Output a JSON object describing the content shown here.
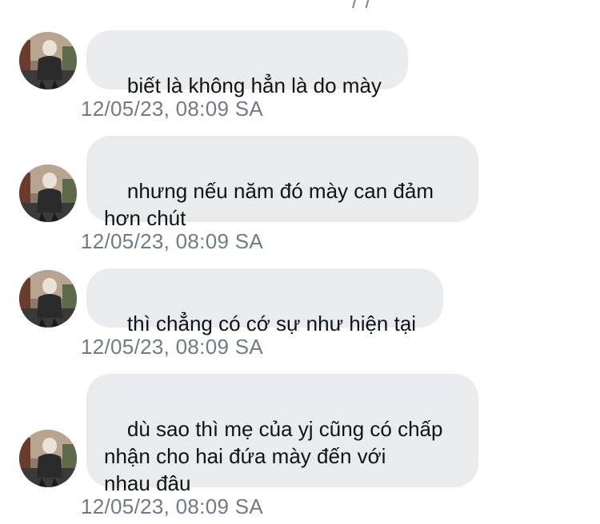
{
  "header": {
    "partial_text": "/ /"
  },
  "messages": [
    {
      "text": "biết là không hẳn là do mày",
      "timestamp": "12/05/23, 08:09 SA",
      "avatar": "user-avatar"
    },
    {
      "text": "nhưng nếu năm đó mày can đảm\nhơn chút",
      "timestamp": "12/05/23, 08:09 SA",
      "avatar": "user-avatar"
    },
    {
      "text": "thì chẳng có cớ sự như hiện tại",
      "timestamp": "12/05/23, 08:09 SA",
      "avatar": "user-avatar"
    },
    {
      "text": "dù sao thì mẹ của yj cũng có chấp\nnhận cho hai đứa mày đến với\nnhau đâu",
      "timestamp": "12/05/23, 08:09 SA",
      "avatar": "user-avatar"
    }
  ],
  "colors": {
    "bubble_bg": "#e9ebef",
    "text": "#0f1419",
    "timestamp": "#6f7b88"
  }
}
